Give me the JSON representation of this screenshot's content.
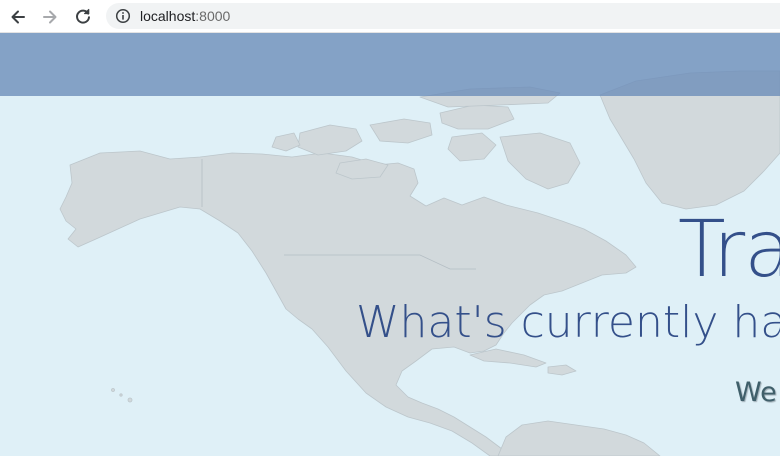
{
  "browser": {
    "url_host": "localhost",
    "url_port": ":8000",
    "icons": {
      "back": "arrow-left-icon",
      "forward": "arrow-right-icon",
      "reload": "reload-icon",
      "info": "info-icon"
    }
  },
  "hero": {
    "title": "Tra",
    "subtitle": "What's currently ha",
    "tagline": "We"
  },
  "colors": {
    "navbar": "#6a8cb9",
    "page_background": "#dff0f7",
    "land": "#d2d9dc",
    "heading": "#34508a",
    "tagline": "#3f5f6a"
  }
}
